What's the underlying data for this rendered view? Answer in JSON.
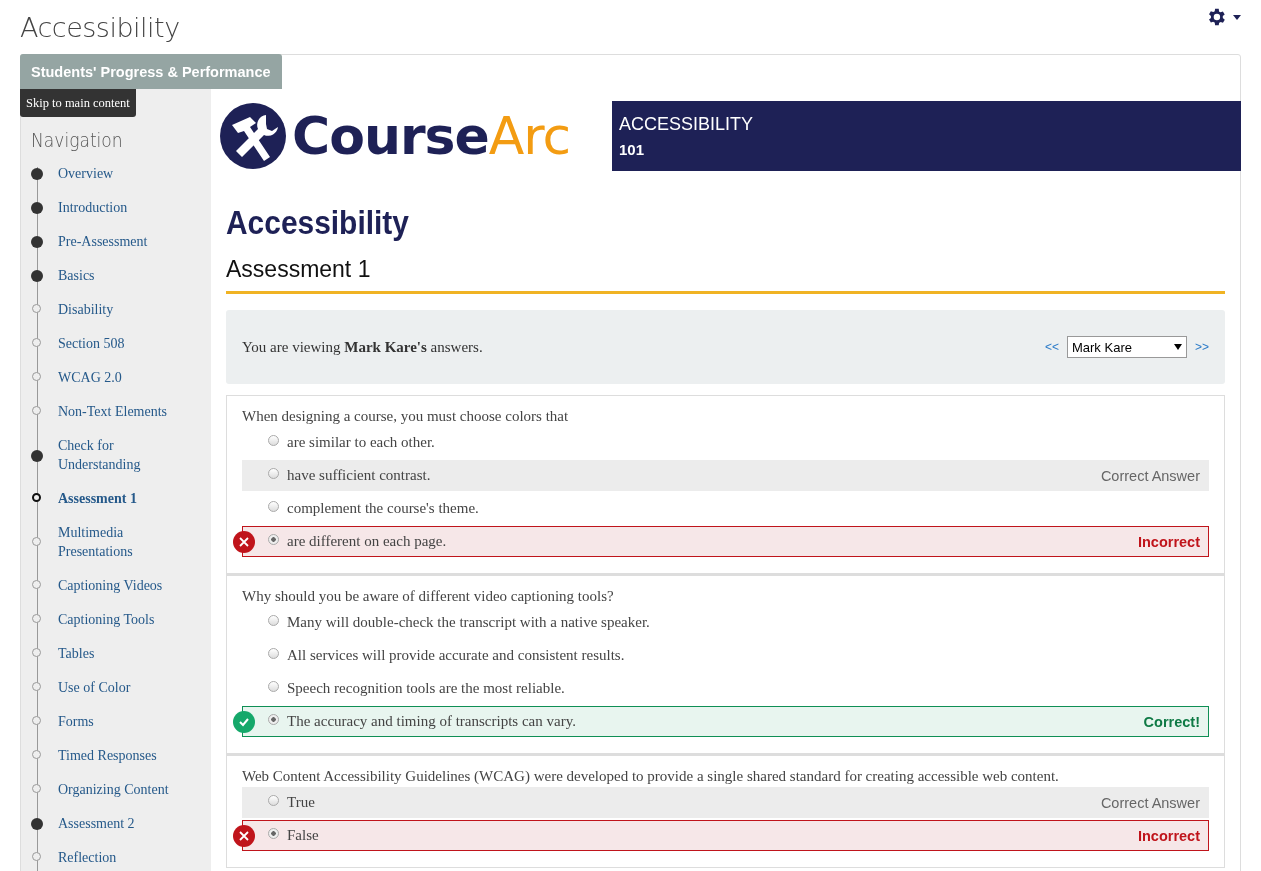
{
  "page_title": "Accessibility",
  "progress_button": "Students' Progress & Performance",
  "skip_tooltip": "Skip to main content",
  "navigation": {
    "heading": "Navigation",
    "items": [
      {
        "label": "Overview",
        "done": true,
        "selected": false
      },
      {
        "label": "Introduction",
        "done": true,
        "selected": false
      },
      {
        "label": "Pre-Assessment",
        "done": true,
        "selected": false
      },
      {
        "label": "Basics",
        "done": true,
        "selected": false
      },
      {
        "label": "Disability",
        "done": false,
        "selected": false
      },
      {
        "label": "Section 508",
        "done": false,
        "selected": false
      },
      {
        "label": "WCAG 2.0",
        "done": false,
        "selected": false
      },
      {
        "label": "Non-Text Elements",
        "done": false,
        "selected": false
      },
      {
        "label": "Check for Understanding",
        "done": true,
        "selected": false
      },
      {
        "label": "Assessment 1",
        "done": false,
        "selected": true
      },
      {
        "label": "Multimedia Presentations",
        "done": false,
        "selected": false
      },
      {
        "label": "Captioning Videos",
        "done": false,
        "selected": false
      },
      {
        "label": "Captioning Tools",
        "done": false,
        "selected": false
      },
      {
        "label": "Tables",
        "done": false,
        "selected": false
      },
      {
        "label": "Use of Color",
        "done": false,
        "selected": false
      },
      {
        "label": "Forms",
        "done": false,
        "selected": false
      },
      {
        "label": "Timed Responses",
        "done": false,
        "selected": false
      },
      {
        "label": "Organizing Content",
        "done": false,
        "selected": false
      },
      {
        "label": "Assessment 2",
        "done": true,
        "selected": false
      },
      {
        "label": "Reflection",
        "done": false,
        "selected": false
      }
    ]
  },
  "logo": {
    "first": "Course",
    "second": "Arc"
  },
  "banner": {
    "title": "ACCESSIBILITY",
    "subtitle": "101"
  },
  "heading": "Accessibility",
  "subheading": "Assessment 1",
  "viewer": {
    "text": "You are viewing **Mark Kare's** answers.",
    "prev": "<<",
    "student": "Mark Kare",
    "next": ">>"
  },
  "questions": [
    {
      "prompt": "When designing a course, you must choose colors that",
      "options": [
        {
          "text": "are similar to each other.",
          "selected": false,
          "kind": "plain"
        },
        {
          "text": "have sufficient contrast.",
          "selected": false,
          "kind": "answer",
          "note": "Correct Answer"
        },
        {
          "text": "complement the course's theme.",
          "selected": false,
          "kind": "plain"
        },
        {
          "text": "are different on each page.",
          "selected": true,
          "kind": "incorrect",
          "note": "Incorrect"
        }
      ]
    },
    {
      "prompt": "Why should you be aware of different video captioning tools?",
      "options": [
        {
          "text": "Many will double-check the transcript with a native speaker.",
          "selected": false,
          "kind": "plain"
        },
        {
          "text": "All services will provide accurate and consistent results.",
          "selected": false,
          "kind": "plain"
        },
        {
          "text": "Speech recognition tools are the most reliable.",
          "selected": false,
          "kind": "plain"
        },
        {
          "text": "The accuracy and timing of transcripts can vary.",
          "selected": true,
          "kind": "correct",
          "note": "Correct!"
        }
      ]
    },
    {
      "prompt": "Web Content Accessibility Guidelines (WCAG) were developed to provide a single shared standard for creating accessible web content.",
      "options": [
        {
          "text": "True",
          "selected": false,
          "kind": "answer",
          "note": "Correct Answer"
        },
        {
          "text": "False",
          "selected": true,
          "kind": "incorrect",
          "note": "Incorrect"
        }
      ]
    }
  ]
}
